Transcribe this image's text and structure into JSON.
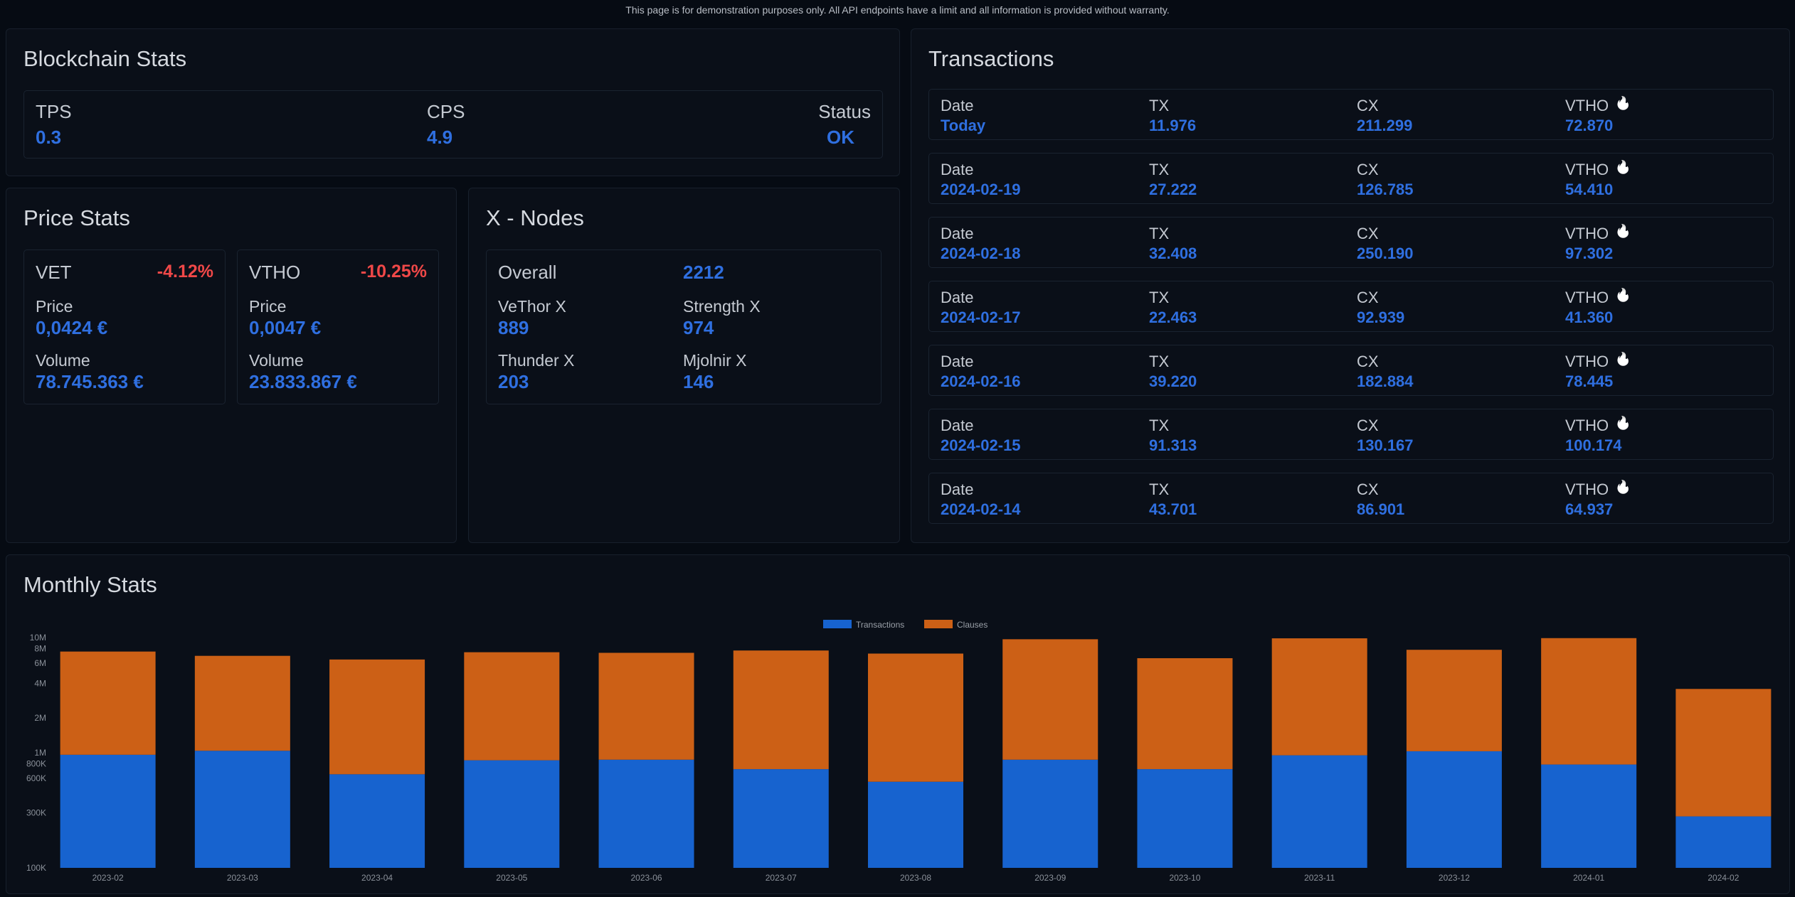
{
  "disclaimer": "This page is for demonstration purposes only. All API endpoints have a limit and all information is provided without warranty.",
  "blockchain_stats": {
    "title": "Blockchain Stats",
    "tps_label": "TPS",
    "tps_value": "0.3",
    "cps_label": "CPS",
    "cps_value": "4.9",
    "status_label": "Status",
    "status_value": "OK"
  },
  "price_stats": {
    "title": "Price Stats",
    "vet": {
      "name": "VET",
      "change": "-4.12%",
      "price_label": "Price",
      "price": "0,0424 €",
      "volume_label": "Volume",
      "volume": "78.745.363 €"
    },
    "vtho": {
      "name": "VTHO",
      "change": "-10.25%",
      "price_label": "Price",
      "price": "0,0047 €",
      "volume_label": "Volume",
      "volume": "23.833.867 €"
    }
  },
  "x_nodes": {
    "title": "X - Nodes",
    "overall_label": "Overall",
    "overall_value": "2212",
    "vethor_label": "VeThor X",
    "vethor_value": "889",
    "strength_label": "Strength X",
    "strength_value": "974",
    "thunder_label": "Thunder X",
    "thunder_value": "203",
    "mjolnir_label": "Mjolnir X",
    "mjolnir_value": "146"
  },
  "transactions": {
    "title": "Transactions",
    "col_labels": [
      "Date",
      "TX",
      "CX",
      "VTHO"
    ],
    "flame_icon": "flame-icon",
    "rows": [
      {
        "date": "Today",
        "tx": "11.976",
        "cx": "211.299",
        "vtho": "72.870"
      },
      {
        "date": "2024-02-19",
        "tx": "27.222",
        "cx": "126.785",
        "vtho": "54.410"
      },
      {
        "date": "2024-02-18",
        "tx": "32.408",
        "cx": "250.190",
        "vtho": "97.302"
      },
      {
        "date": "2024-02-17",
        "tx": "22.463",
        "cx": "92.939",
        "vtho": "41.360"
      },
      {
        "date": "2024-02-16",
        "tx": "39.220",
        "cx": "182.884",
        "vtho": "78.445"
      },
      {
        "date": "2024-02-15",
        "tx": "91.313",
        "cx": "130.167",
        "vtho": "100.174"
      },
      {
        "date": "2024-02-14",
        "tx": "43.701",
        "cx": "86.901",
        "vtho": "64.937"
      }
    ]
  },
  "monthly_stats": {
    "title": "Monthly Stats"
  },
  "colors": {
    "accent_blue": "#2f6fe0",
    "negative_red": "#f04848",
    "transactions_series": "#1763cf",
    "clauses_series": "#cc6016"
  },
  "chart_data": {
    "type": "bar",
    "stacked": true,
    "y_scale": "log",
    "ylim": [
      100000,
      10000000
    ],
    "y_ticks": [
      100000,
      300000,
      600000,
      800000,
      1000000,
      2000000,
      4000000,
      6000000,
      8000000,
      10000000
    ],
    "y_tick_labels": [
      "100K",
      "300K",
      "600K",
      "800K",
      "1M",
      "2M",
      "4M",
      "6M",
      "8M",
      "10M"
    ],
    "legend_position": "top-center",
    "grid": false,
    "categories": [
      "2023-02",
      "2023-03",
      "2023-04",
      "2023-05",
      "2023-06",
      "2023-07",
      "2023-08",
      "2023-09",
      "2023-10",
      "2023-11",
      "2023-12",
      "2024-01",
      "2024-02"
    ],
    "series": [
      {
        "name": "Transactions",
        "color": "#1763cf",
        "values": [
          960000,
          1040000,
          650000,
          860000,
          870000,
          720000,
          560000,
          870000,
          720000,
          950000,
          1030000,
          790000,
          280000
        ]
      },
      {
        "name": "Clauses",
        "color": "#cc6016",
        "values": [
          6600000,
          5900000,
          5800000,
          6600000,
          6500000,
          7000000,
          6700000,
          8800000,
          5900000,
          8900000,
          6800000,
          9100000,
          3300000
        ]
      }
    ]
  }
}
